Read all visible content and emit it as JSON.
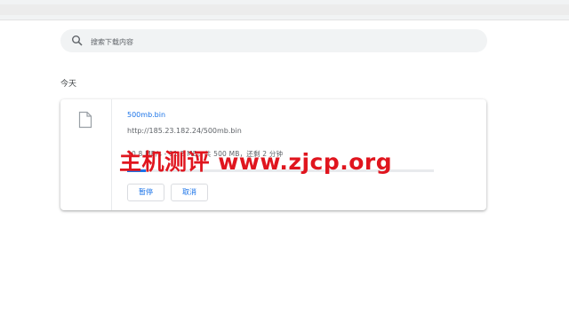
{
  "search": {
    "placeholder": "搜索下载内容"
  },
  "section": {
    "title": "今天"
  },
  "download": {
    "file_name": "500mb.bin",
    "url": "http://185.23.182.24/500mb.bin",
    "status": "10.8 MB/s - 11.2 MB，共 500 MB，还剩 2 分钟",
    "progress_fraction": 0.06,
    "pause_label": "暂停",
    "cancel_label": "取消"
  },
  "watermark": {
    "text": "主机测评 www.zjcp.org"
  },
  "colors": {
    "accent": "#1a73e8",
    "watermark": "#e0151e"
  },
  "icons": {
    "search": "search-icon",
    "file": "file-icon"
  }
}
